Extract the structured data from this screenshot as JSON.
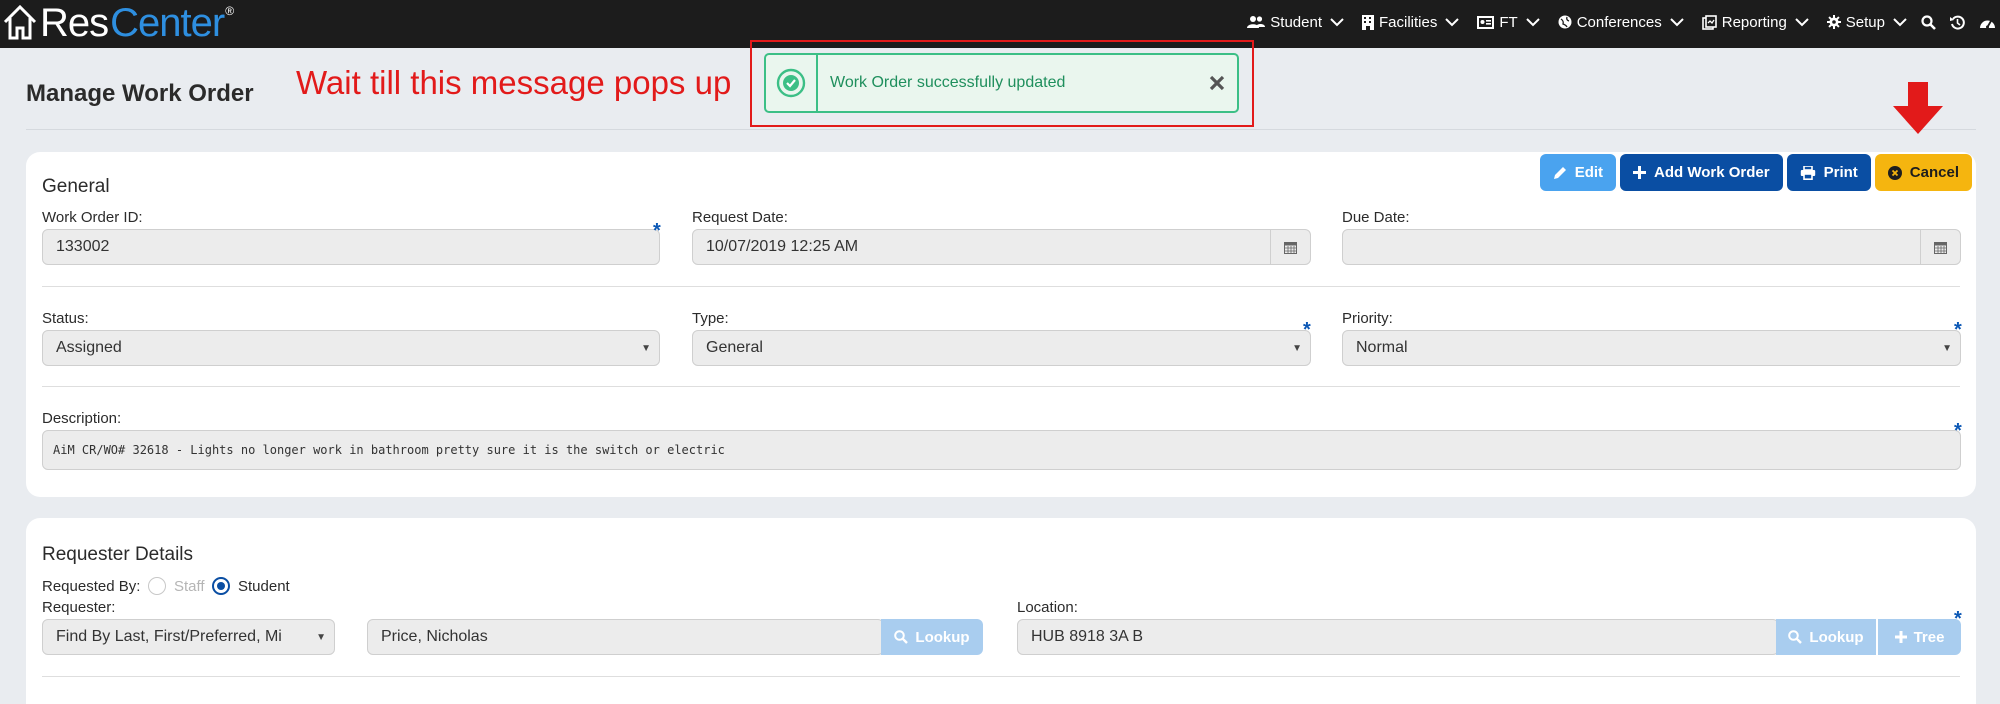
{
  "nav": {
    "logo_res": "Res",
    "logo_center": "Center",
    "logo_reg": "®",
    "items": [
      {
        "label": "Student",
        "icon": "users-icon"
      },
      {
        "label": "Facilities",
        "icon": "building-icon"
      },
      {
        "label": "FT",
        "icon": "id-card-icon"
      },
      {
        "label": "Conferences",
        "icon": "globe-icon"
      },
      {
        "label": "Reporting",
        "icon": "report-icon"
      },
      {
        "label": "Setup",
        "icon": "gear-icon"
      }
    ],
    "right_icons": [
      "search-icon",
      "history-icon",
      "dashboard-icon"
    ]
  },
  "header": {
    "title": "Manage Work Order",
    "annotation": "Wait till this message pops up",
    "toast_message": "Work Order successfully updated"
  },
  "general": {
    "title": "General",
    "buttons": {
      "edit": "Edit",
      "add": "Add Work Order",
      "print": "Print",
      "cancel": "Cancel"
    },
    "work_order_id_label": "Work Order ID:",
    "work_order_id": "133002",
    "request_date_label": "Request Date:",
    "request_date": "10/07/2019 12:25 AM",
    "due_date_label": "Due Date:",
    "due_date": "",
    "status_label": "Status:",
    "status": "Assigned",
    "type_label": "Type:",
    "type": "General",
    "priority_label": "Priority:",
    "priority": "Normal",
    "description_label": "Description:",
    "description": "AiM CR/WO# 32618 - Lights no longer work in bathroom pretty sure it is the switch or electric"
  },
  "requester": {
    "title": "Requester Details",
    "requested_by_label": "Requested By:",
    "options": {
      "staff": "Staff",
      "student": "Student"
    },
    "selected": "Student",
    "requester_label": "Requester:",
    "requester_mode": "Find By Last, First/Preferred, Mi",
    "requester_name": "Price, Nicholas",
    "lookup_label": "Lookup",
    "location_label": "Location:",
    "location": "HUB 8918 3A B",
    "location_lookup_label": "Lookup",
    "tree_label": "Tree"
  },
  "colors": {
    "nav_bg": "#1c1c1c",
    "brand_blue": "#2e8fe0",
    "primary": "#0a4ea3",
    "info": "#4aa3ef",
    "warning": "#f5b50f",
    "success": "#3cbf86",
    "annotation_red": "#e21a1a"
  }
}
